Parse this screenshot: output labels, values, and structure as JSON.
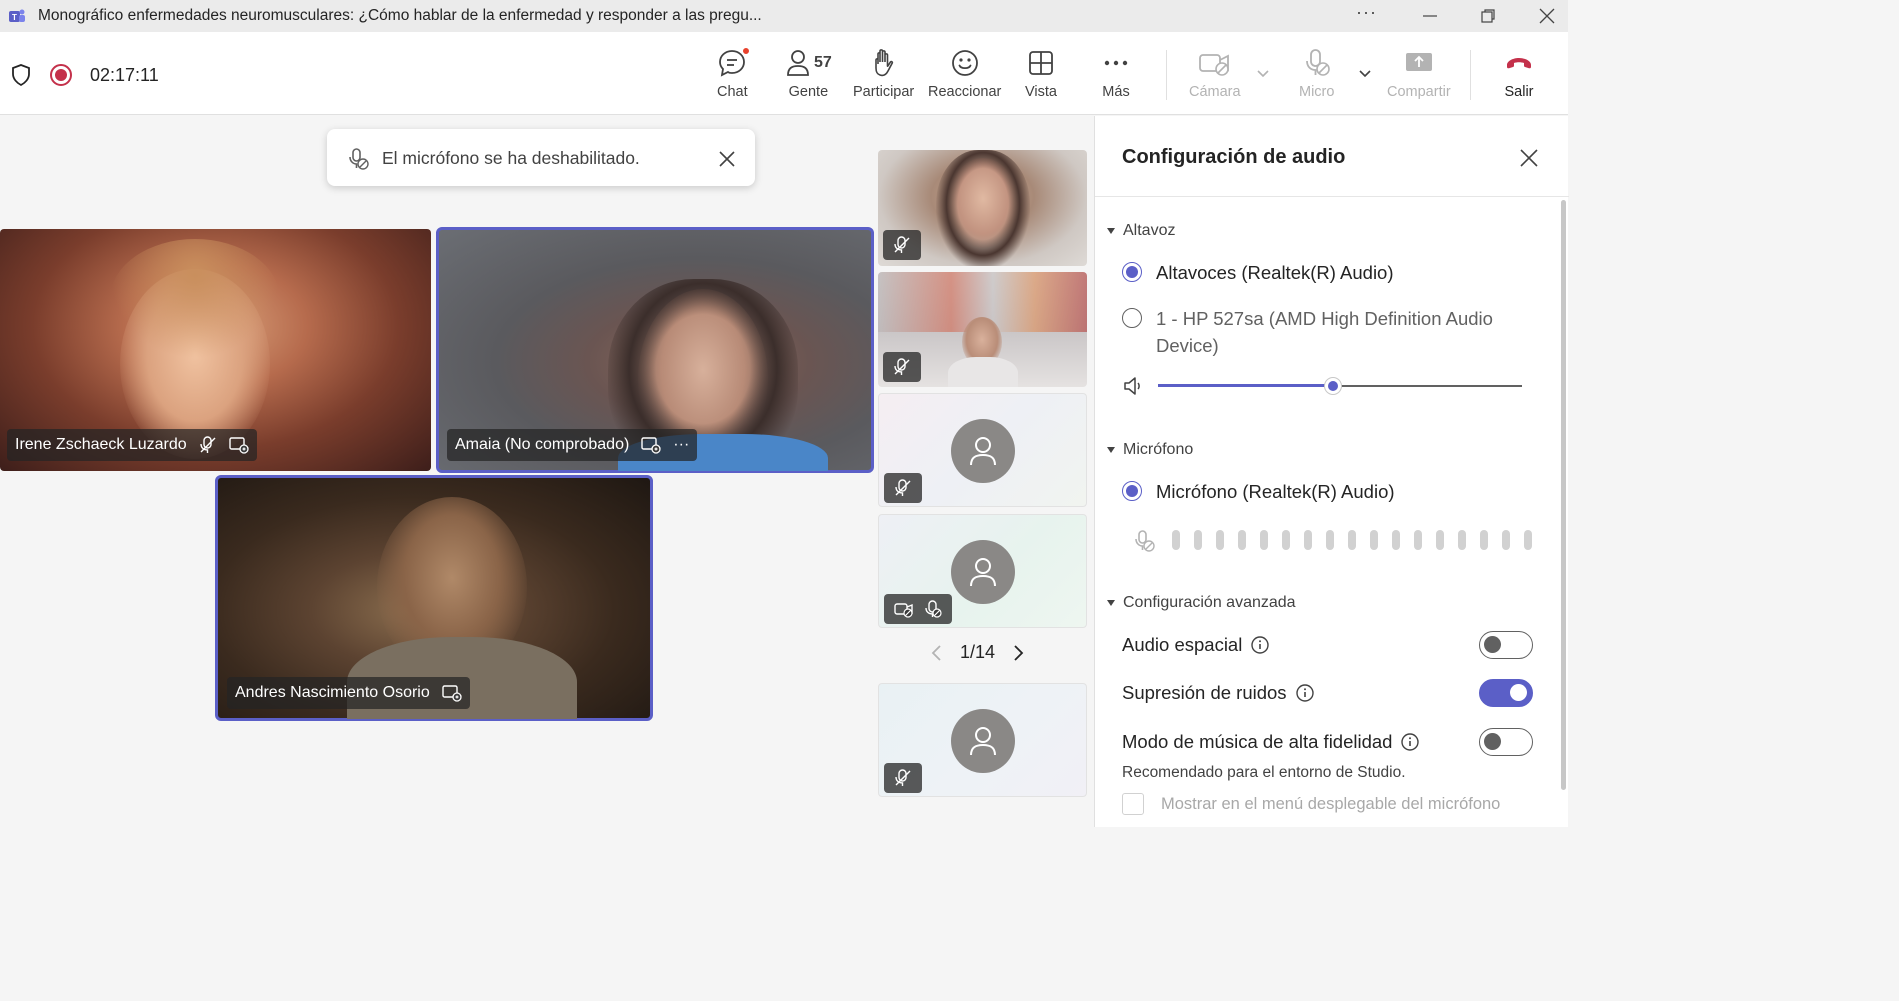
{
  "window": {
    "title": "Monográfico enfermedades neuromusculares: ¿Cómo hablar de la enfermedad y responder a las pregu...",
    "more": "···"
  },
  "toolbar": {
    "timer": "02:17:11",
    "chat": "Chat",
    "people": "Gente",
    "people_count": "57",
    "raise_hand": "Participar",
    "react": "Reaccionar",
    "view": "Vista",
    "more": "Más",
    "camera": "Cámara",
    "mic": "Micro",
    "share": "Compartir",
    "leave": "Salir"
  },
  "toast": {
    "text": "El micrófono se ha deshabilitado."
  },
  "participants": {
    "irene": "Irene Zschaeck Luzardo",
    "amaia": "Amaia (No comprobado)",
    "andres": "Andres Nascimiento Osorio",
    "more_dots": "···"
  },
  "gallery": {
    "page": "1/14"
  },
  "panel": {
    "title": "Configuración de audio",
    "speaker_section": "Altavoz",
    "speaker_options": [
      {
        "label": "Altavoces (Realtek(R) Audio)",
        "selected": true
      },
      {
        "label": "1 - HP 527sa (AMD High Definition Audio Device)",
        "selected": false
      }
    ],
    "volume_fraction": 0.48,
    "mic_section": "Micrófono",
    "mic_option": "Micrófono (Realtek(R) Audio)",
    "mic_level_bars": 17,
    "advanced_section": "Configuración avanzada",
    "spatial_audio": "Audio espacial",
    "spatial_audio_on": false,
    "noise_suppression": "Supresión de ruidos",
    "noise_suppression_on": true,
    "hifi_music": "Modo de música de alta fidelidad",
    "hifi_music_on": false,
    "hifi_hint": "Recomendado para el entorno de Studio.",
    "show_in_menu": "Mostrar en el menú desplegable del micrófono"
  },
  "colors": {
    "accent": "#5b5fc7",
    "leave": "#c4314b",
    "record": "#c4314b"
  }
}
